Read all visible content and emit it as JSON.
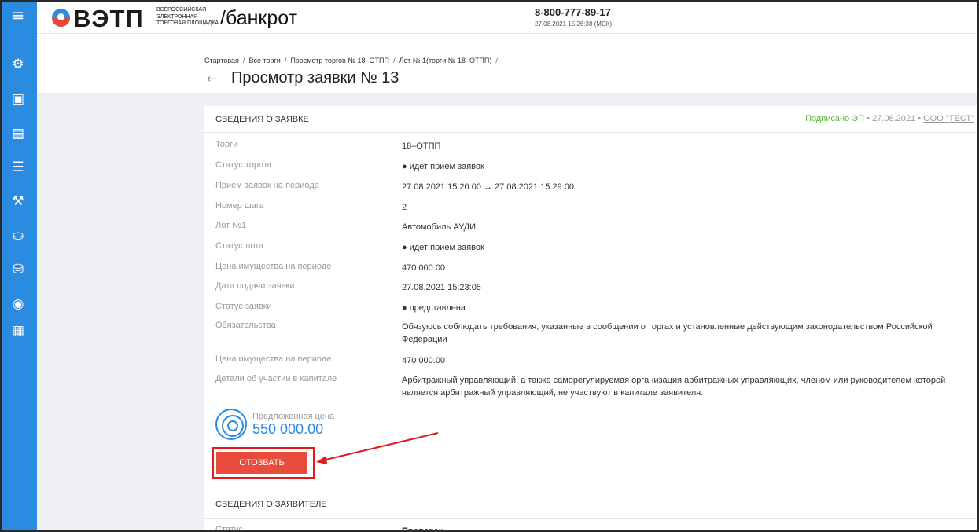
{
  "sidebar": {
    "items": [
      {
        "icon": "menu-icon",
        "glyph": "≡"
      },
      {
        "icon": "settings-icon",
        "glyph": "⚙"
      },
      {
        "icon": "document-icon",
        "glyph": "▣"
      },
      {
        "icon": "scroll-icon",
        "glyph": "▤"
      },
      {
        "icon": "list-icon",
        "glyph": "☰"
      },
      {
        "icon": "gavel-icon",
        "glyph": "⚒"
      },
      {
        "icon": "hand-icon",
        "glyph": "⛀"
      },
      {
        "icon": "hand-coin-icon",
        "glyph": "⛁"
      },
      {
        "icon": "moneybag-icon",
        "glyph": "◉"
      },
      {
        "icon": "contact-card-icon",
        "glyph": "▦"
      }
    ]
  },
  "header": {
    "logo_text": "ВЭТП",
    "logo_sub_1": "Всероссийская",
    "logo_sub_2": "электронная",
    "logo_sub_3": "торговая площадка",
    "section": "/банкрот",
    "phone": "8-800-777-89-17",
    "datetime": "27.08.2021 15:26:38 (МСК)"
  },
  "breadcrumb": {
    "items": [
      "Стартовая",
      "Все торги",
      "Просмотр торгов № 18–ОТПП",
      "Лот № 1(торги № 18–ОТПП)"
    ],
    "sep": "/"
  },
  "page": {
    "back_glyph": "←",
    "title": "Просмотр заявки № 13"
  },
  "application": {
    "section_title": "СВЕДЕНИЯ О ЗАЯВКЕ",
    "signed_status": "Подписано ЭП",
    "signed_date": "27.08.2021",
    "signed_org": "ООО \"ТЕСТ\"",
    "fields": [
      {
        "label": "Торги",
        "value": "18–ОТПП"
      },
      {
        "label": "Статус торгов",
        "value": "● идет прием заявок"
      },
      {
        "label": "Прием заявок на периоде",
        "value": "27.08.2021 15:20:00 → 27.08.2021 15:29:00"
      },
      {
        "label": "Номер шага",
        "value": "2"
      },
      {
        "label": "Лот №1",
        "value": "Автомобиль АУДИ"
      },
      {
        "label": "Статус лота",
        "value": "● идет прием заявок"
      },
      {
        "label": "Цена имущества на периоде",
        "value": "470 000.00"
      },
      {
        "label": "Дата подачи заявки",
        "value": "27.08.2021 15:23:05"
      },
      {
        "label": "Статус заявки",
        "value": "● представлена"
      },
      {
        "label": "Обязательства",
        "value": "Обязуюсь соблюдать требования, указанные в сообщении о торгах и установленные действующим законодательством Российской Федерации"
      },
      {
        "label": "Цена имущества на периоде",
        "value": "470 000.00"
      },
      {
        "label": "Детали об участии в капитале",
        "value": "Арбитражный управляющий, а также саморегулируемая организация арбитражных управляющих, членом или руководителем которой является арбитражный управляющий, не участвуют в капитале заявителя."
      }
    ],
    "offered_price_label": "Предложенная цена",
    "offered_price": "550 000.00",
    "withdraw_label": "ОТОЗВАТЬ"
  },
  "applicant": {
    "section_title": "СВЕДЕНИЯ О ЗАЯВИТЕЛЕ",
    "fields": [
      {
        "label": "Статус",
        "value": "Проверен"
      }
    ]
  },
  "colors": {
    "sidebar": "#2b8be0",
    "accent": "#2b8be0",
    "danger": "#e84c3d",
    "highlight": "#e01b1b",
    "ok": "#3db03d"
  }
}
